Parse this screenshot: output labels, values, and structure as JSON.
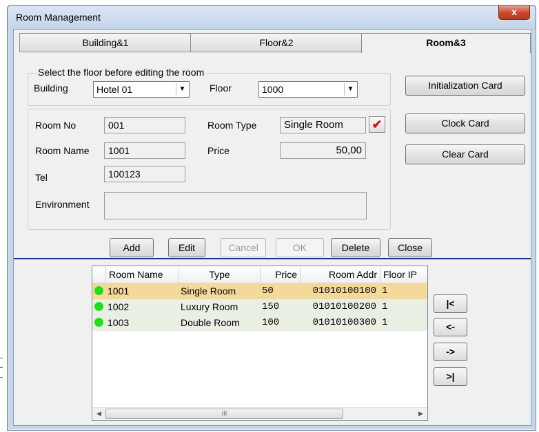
{
  "window": {
    "title": "Room Management",
    "close_label": "x"
  },
  "tabs": [
    {
      "label": "Building&1"
    },
    {
      "label": "Floor&2"
    },
    {
      "label": "Room&3",
      "active": true
    }
  ],
  "floor_select": {
    "legend": "Select the floor before editing the room",
    "building_label": "Building",
    "building_value": "Hotel 01",
    "floor_label": "Floor",
    "floor_value": "1000"
  },
  "room": {
    "room_no_label": "Room No",
    "room_no": "001",
    "room_type_label": "Room Type",
    "room_type": "Single Room",
    "room_name_label": "Room Name",
    "room_name": "1001",
    "price_label": "Price",
    "price": "50,00",
    "tel_label": "Tel",
    "tel": "100123",
    "environment_label": "Environment",
    "environment": ""
  },
  "side_buttons": {
    "init_card": "Initialization Card",
    "clock_card": "Clock Card",
    "clear_card": "Clear Card"
  },
  "actions": {
    "add": "Add",
    "edit": "Edit",
    "cancel": "Cancel",
    "ok": "OK",
    "delete": "Delete",
    "close": "Close"
  },
  "grid": {
    "columns": [
      "Room Name",
      "Type",
      "Price",
      "Room Addr",
      "Floor IP"
    ],
    "rows": [
      {
        "name": "1001",
        "type": "Single Room",
        "price": "50",
        "addr": "01010100100",
        "floor_ip": "1",
        "selected": true
      },
      {
        "name": "1002",
        "type": "Luxury Room",
        "price": "150",
        "addr": "01010100200",
        "floor_ip": "1"
      },
      {
        "name": "1003",
        "type": "Double Room",
        "price": "100",
        "addr": "01010100300",
        "floor_ip": "1"
      }
    ],
    "scroll_thumb": "III"
  },
  "nav": {
    "first": "|<",
    "prev": "<-",
    "next": "->",
    "last": ">|"
  },
  "colors": {
    "selected_row": "#f5d99a",
    "alt_row": "#e9f0e3",
    "status_dot": "#1de01d",
    "separator": "#1c2f86"
  }
}
